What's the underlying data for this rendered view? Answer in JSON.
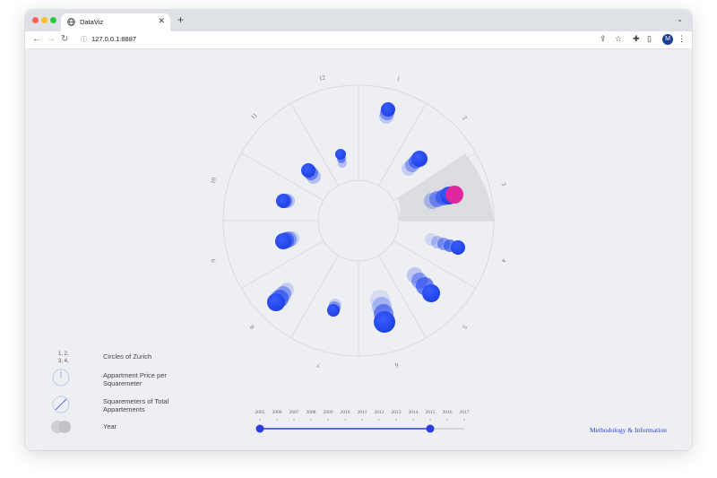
{
  "browser": {
    "tab_title": "DataViz",
    "url": "127.0.0.1:8887",
    "avatar_initial": "M"
  },
  "viz": {
    "months": [
      "1",
      "2",
      "3",
      "4",
      "5",
      "6",
      "7",
      "8",
      "9",
      "10",
      "11",
      "12"
    ],
    "highlighted_month": "3",
    "accent": "#2b4ef0",
    "highlight_color": "#e0259f"
  },
  "legend": {
    "circles_numbers": "1, 2, 3, 4,",
    "circles_label": "Circles of Zurich",
    "price_label": "Appartment Price per Squaremeter",
    "sqm_label": "Squaremeters of Total Appartements",
    "year_label": "Year"
  },
  "timeline": {
    "years": [
      "2005",
      "2006",
      "2007",
      "2008",
      "2009",
      "2010",
      "2011",
      "2012",
      "2013",
      "2014",
      "2015",
      "2016",
      "2017"
    ],
    "range_start": "2005",
    "range_end": "2015"
  },
  "methodology_link": "Methodology & Information"
}
